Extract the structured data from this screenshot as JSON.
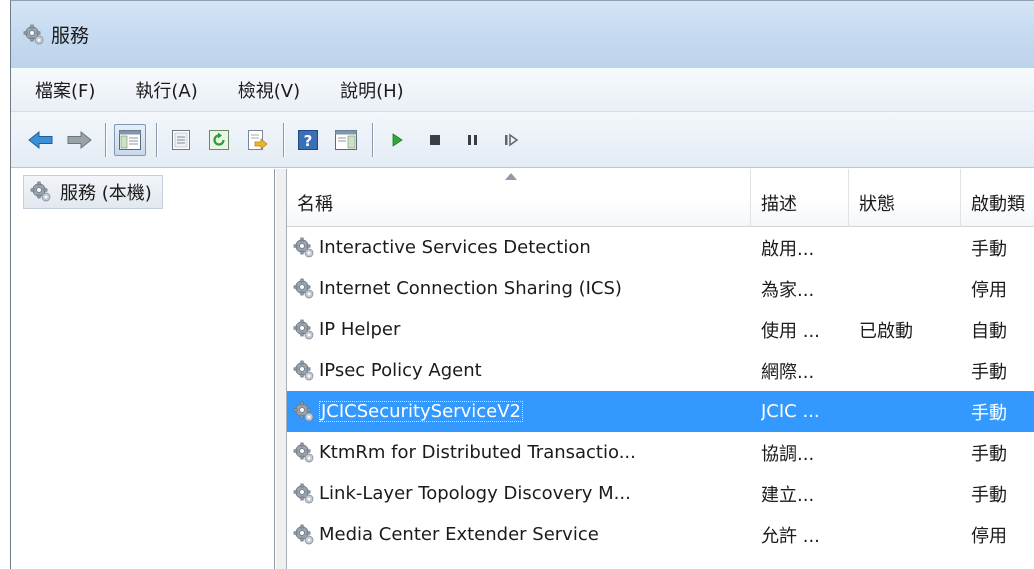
{
  "window": {
    "title": "服務"
  },
  "menubar": {
    "items": [
      {
        "label": "檔案(F)"
      },
      {
        "label": "執行(A)"
      },
      {
        "label": "檢視(V)"
      },
      {
        "label": "說明(H)"
      }
    ]
  },
  "toolbar": {
    "buttons": [
      {
        "icon": "back-arrow-icon"
      },
      {
        "icon": "forward-arrow-icon"
      },
      {
        "icon": "show-hide-console-tree-icon",
        "active": true
      },
      {
        "icon": "properties-icon"
      },
      {
        "icon": "refresh-icon"
      },
      {
        "icon": "export-list-icon"
      },
      {
        "icon": "help-icon"
      },
      {
        "icon": "show-action-pane-icon"
      },
      {
        "icon": "start-service-icon"
      },
      {
        "icon": "stop-service-icon"
      },
      {
        "icon": "pause-service-icon"
      },
      {
        "icon": "resume-service-icon"
      }
    ]
  },
  "tree": {
    "root_label": "服務 (本機)"
  },
  "list": {
    "columns": {
      "name": "名稱",
      "description": "描述",
      "status": "狀態",
      "startup": "啟動類"
    },
    "rows": [
      {
        "name": "Interactive Services Detection",
        "description": "啟用...",
        "status": "",
        "startup": "手動",
        "selected": false
      },
      {
        "name": "Internet Connection Sharing (ICS)",
        "description": "為家...",
        "status": "",
        "startup": "停用",
        "selected": false
      },
      {
        "name": "IP Helper",
        "description": "使用 ...",
        "status": "已啟動",
        "startup": "自動",
        "selected": false
      },
      {
        "name": "IPsec Policy Agent",
        "description": "網際...",
        "status": "",
        "startup": "手動",
        "selected": false
      },
      {
        "name": "JCICSecurityServiceV2",
        "description": "JCIC ...",
        "status": "",
        "startup": "手動",
        "selected": true
      },
      {
        "name": "KtmRm for Distributed Transactio...",
        "description": "協調...",
        "status": "",
        "startup": "手動",
        "selected": false
      },
      {
        "name": "Link-Layer Topology Discovery M...",
        "description": "建立...",
        "status": "",
        "startup": "手動",
        "selected": false
      },
      {
        "name": "Media Center Extender Service",
        "description": "允許 ...",
        "status": "",
        "startup": "停用",
        "selected": false
      }
    ]
  },
  "colors": {
    "selection": "#3399ff",
    "titlebar": "#c7dbf0"
  }
}
